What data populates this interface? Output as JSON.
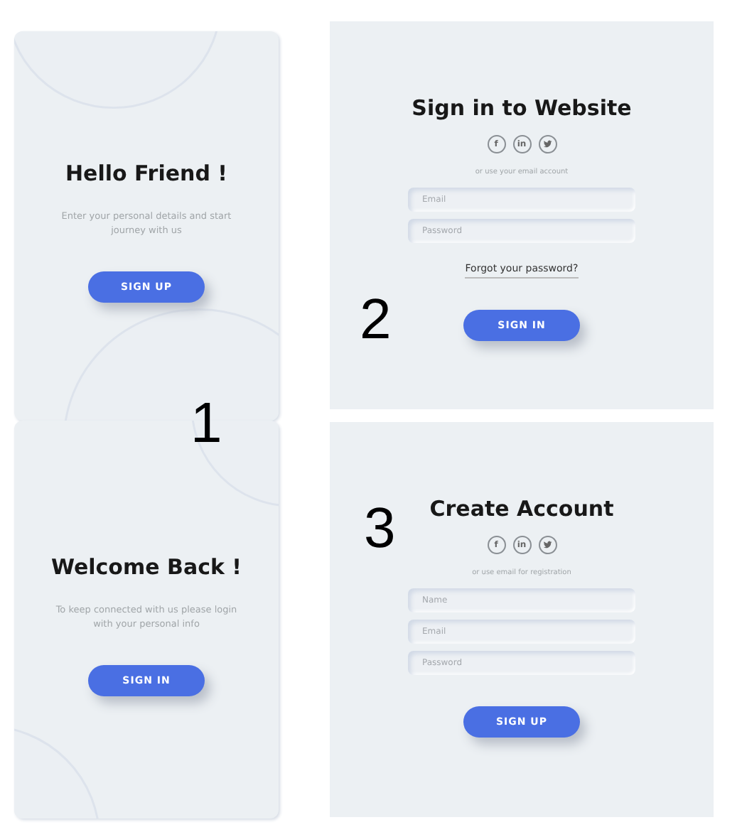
{
  "panels": [
    {
      "kind": "overlay",
      "title": "Hello Friend !",
      "text": "Enter your personal details and start journey with us",
      "button": "SIGN UP"
    },
    {
      "kind": "form",
      "title": "Sign in to Website",
      "social": [
        {
          "kind": "letter",
          "glyph": "f"
        },
        {
          "kind": "letter",
          "glyph": "in"
        },
        {
          "kind": "bird"
        }
      ],
      "hint": "or use your email account",
      "fields": [
        {
          "placeholder": "Email"
        },
        {
          "placeholder": "Password"
        }
      ],
      "link": "Forgot your password?",
      "button": "SIGN IN"
    },
    {
      "kind": "overlay",
      "title": "Welcome Back !",
      "text": "To keep connected with us please login with your personal info",
      "button": "SIGN IN"
    },
    {
      "kind": "form",
      "title": "Create Account",
      "social": [
        {
          "kind": "letter",
          "glyph": "f"
        },
        {
          "kind": "letter",
          "glyph": "in"
        },
        {
          "kind": "bird"
        }
      ],
      "hint": "or use email for registration",
      "fields": [
        {
          "placeholder": "Name"
        },
        {
          "placeholder": "Email"
        },
        {
          "placeholder": "Password"
        }
      ],
      "button": "SIGN UP"
    }
  ],
  "labels": [
    "1",
    "2",
    "3"
  ]
}
